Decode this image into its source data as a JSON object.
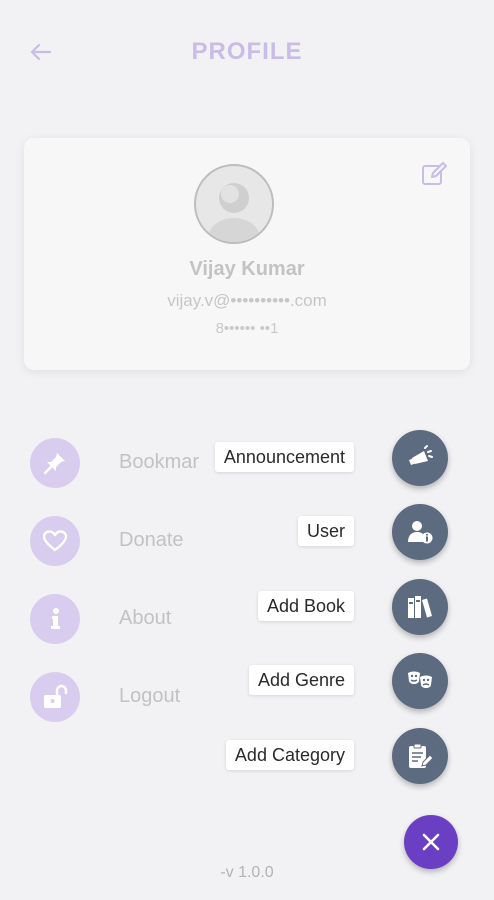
{
  "header": {
    "title": "PROFILE",
    "back_icon": "arrow-left-icon"
  },
  "profile": {
    "name": "Vijay Kumar",
    "email": "vijay.v@••••••••••.com",
    "phone": "8•••••• ••1",
    "edit_icon": "edit-icon"
  },
  "menu": [
    {
      "label": "Bookmar",
      "icon": "pin-icon"
    },
    {
      "label": "Donate",
      "icon": "heart-icon"
    },
    {
      "label": "About",
      "icon": "info-icon"
    },
    {
      "label": "Logout",
      "icon": "unlock-icon"
    }
  ],
  "fab_actions": [
    {
      "label": "Announcement",
      "icon": "megaphone-icon"
    },
    {
      "label": "User",
      "icon": "user-info-icon"
    },
    {
      "label": "Add Book",
      "icon": "books-icon"
    },
    {
      "label": "Add Genre",
      "icon": "theater-masks-icon"
    },
    {
      "label": "Add Category",
      "icon": "clipboard-edit-icon"
    }
  ],
  "close_icon": "close-icon",
  "version": "-v 1.0.0",
  "colors": {
    "accent": "#6a3fc4",
    "fab": "#5d6b80",
    "menu_circle": "#d9cdef",
    "title": "#c9bde6"
  }
}
